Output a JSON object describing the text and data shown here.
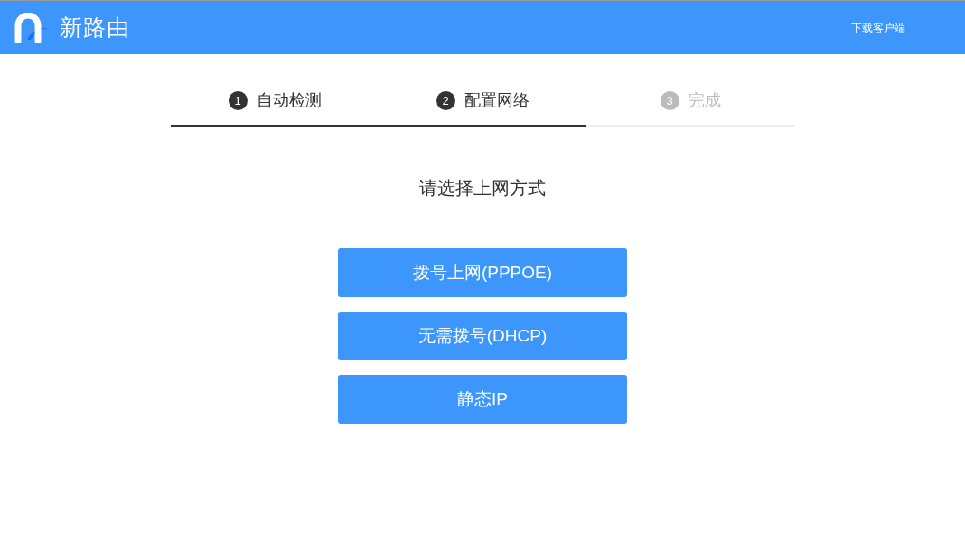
{
  "header": {
    "brand": "新路由",
    "download_link": "下载客户端"
  },
  "steps": [
    {
      "number": "1",
      "label": "自动检测",
      "active": true
    },
    {
      "number": "2",
      "label": "配置网络",
      "active": true
    },
    {
      "number": "3",
      "label": "完成",
      "active": false
    }
  ],
  "title": "请选择上网方式",
  "options": [
    "拨号上网(PPPOE)",
    "无需拨号(DHCP)",
    "静态IP"
  ]
}
